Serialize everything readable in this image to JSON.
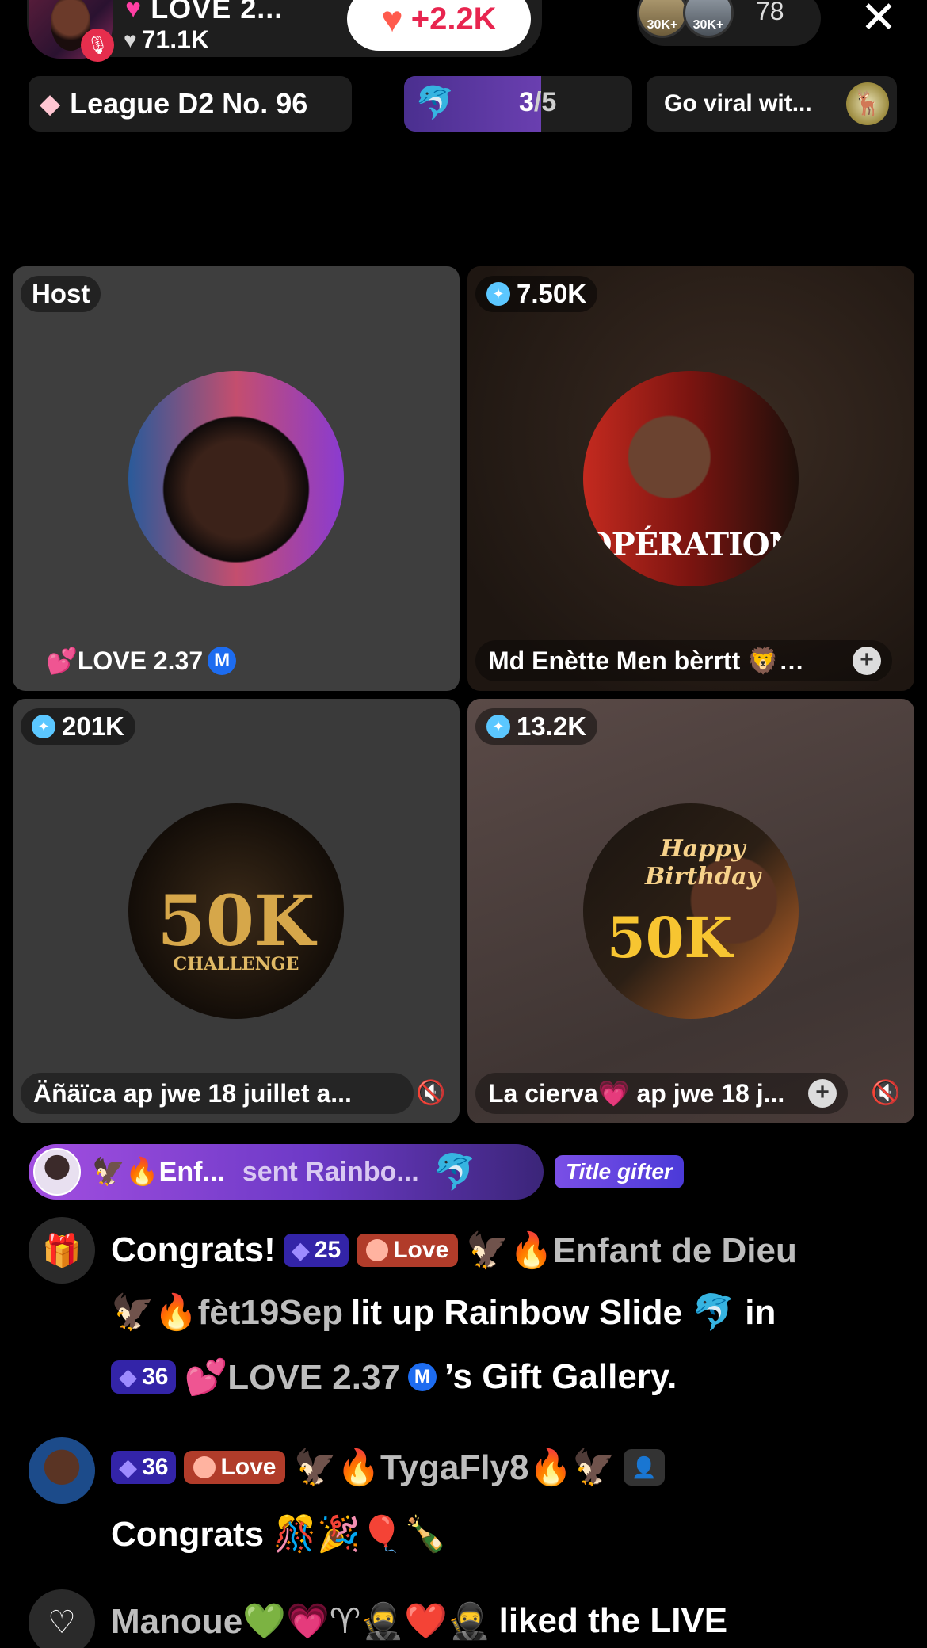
{
  "header": {
    "host_title": "LOVE 2...",
    "likes": "71.1K",
    "boost": "+2.2K",
    "viewer_badges": [
      "30K+",
      "30K+"
    ],
    "viewer_count": "78"
  },
  "subheader": {
    "league": "League D2 No. 96",
    "progress_current": "3",
    "progress_total": "/5",
    "progress_fraction": 0.6,
    "viral_label": "Go viral wit..."
  },
  "tiles": [
    {
      "badge": "Host",
      "name": "💕LOVE 2.37",
      "m": "M"
    },
    {
      "badge": "7.50K",
      "name": "Md Enètte Men bèrrtt 🦁…",
      "art": "OPÉRATION"
    },
    {
      "badge": "201K",
      "name": "Äñäïca  ap jwe 18 juillet a...",
      "art": "50K",
      "art_sub": "CHALLENGE"
    },
    {
      "badge": "13.2K",
      "name": "La cierva💗 ap jwe 18 j...",
      "art": "50K",
      "art_top": "Happy Birthday"
    }
  ],
  "gift_banner": {
    "sender": "🦅🔥Enf...",
    "action": "sent Rainbo...",
    "icon": "🐬",
    "title_gifter": "Title gifter"
  },
  "chat": {
    "msg1": {
      "congrats": "Congrats!",
      "level": "25",
      "love": "Love",
      "user": "🦅🔥Enfant de Dieu",
      "user2": "🦅🔥fèt19Sep",
      "text": "lit up Rainbow Slide 🐬 in",
      "level2": "36",
      "host": "💕LOVE 2.37",
      "m": "M",
      "suffix": "’s Gift Gallery."
    },
    "msg2": {
      "level": "36",
      "love": "Love",
      "user": "🦅🔥TygaFly8🔥🦅",
      "text": "Congrats 🎊🎉🎈🍾"
    },
    "msg3": {
      "user": "Manoue💚💗♈🥷❤️🥷",
      "text": "liked the LIVE"
    }
  }
}
